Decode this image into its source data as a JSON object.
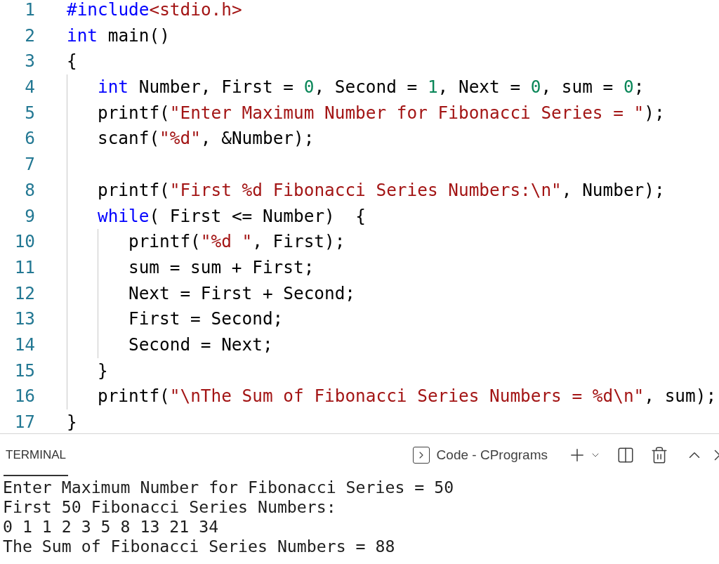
{
  "editor": {
    "lines": [
      {
        "number": "1",
        "tokens": [
          {
            "kind": "keyword",
            "text": "#include"
          },
          {
            "kind": "string",
            "text": "<stdio.h>"
          }
        ]
      },
      {
        "number": "2",
        "tokens": [
          {
            "kind": "keyword",
            "text": "int"
          },
          {
            "kind": "plain",
            "text": " main()"
          }
        ]
      },
      {
        "number": "3",
        "tokens": [
          {
            "kind": "plain",
            "text": "{"
          }
        ],
        "children": [
          {
            "number": "4",
            "tokens": [
              {
                "kind": "keyword",
                "text": "int"
              },
              {
                "kind": "plain",
                "text": " Number, First = "
              },
              {
                "kind": "number",
                "text": "0"
              },
              {
                "kind": "plain",
                "text": ", Second = "
              },
              {
                "kind": "number",
                "text": "1"
              },
              {
                "kind": "plain",
                "text": ", Next = "
              },
              {
                "kind": "number",
                "text": "0"
              },
              {
                "kind": "plain",
                "text": ", sum = "
              },
              {
                "kind": "number",
                "text": "0"
              },
              {
                "kind": "plain",
                "text": ";"
              }
            ]
          },
          {
            "number": "5",
            "tokens": [
              {
                "kind": "plain",
                "text": "printf("
              },
              {
                "kind": "string",
                "text": "\"Enter Maximum Number for Fibonacci Series = \""
              },
              {
                "kind": "plain",
                "text": ");"
              }
            ]
          },
          {
            "number": "6",
            "tokens": [
              {
                "kind": "plain",
                "text": "scanf("
              },
              {
                "kind": "string",
                "text": "\"%d\""
              },
              {
                "kind": "plain",
                "text": ", &Number);"
              }
            ]
          },
          {
            "number": "7"
          },
          {
            "number": "8",
            "tokens": [
              {
                "kind": "plain",
                "text": "printf("
              },
              {
                "kind": "string",
                "text": "\"First %d Fibonacci Series Numbers:\\n\""
              },
              {
                "kind": "plain",
                "text": ", Number);"
              }
            ]
          },
          {
            "number": "9",
            "tokens": [
              {
                "kind": "keyword",
                "text": "while"
              },
              {
                "kind": "plain",
                "text": "( First <= Number)  {"
              }
            ],
            "children": [
              {
                "number": "10",
                "tokens": [
                  {
                    "kind": "plain",
                    "text": "printf("
                  },
                  {
                    "kind": "string",
                    "text": "\"%d \""
                  },
                  {
                    "kind": "plain",
                    "text": ", First);"
                  }
                ]
              },
              {
                "number": "11",
                "tokens": [
                  {
                    "kind": "plain",
                    "text": "sum = sum + First;"
                  }
                ]
              },
              {
                "number": "12",
                "tokens": [
                  {
                    "kind": "plain",
                    "text": "Next = First + Second;"
                  }
                ]
              },
              {
                "number": "13",
                "tokens": [
                  {
                    "kind": "plain",
                    "text": "First = Second;"
                  }
                ]
              },
              {
                "number": "14",
                "tokens": [
                  {
                    "kind": "plain",
                    "text": "Second = Next;"
                  }
                ]
              }
            ]
          },
          {
            "number": "15",
            "tokens": [
              {
                "kind": "plain",
                "text": "}"
              }
            ]
          },
          {
            "number": "16",
            "tokens": [
              {
                "kind": "plain",
                "text": "printf("
              },
              {
                "kind": "string",
                "text": "\"\\nThe Sum of Fibonacci Series Numbers = %d\\n\""
              },
              {
                "kind": "plain",
                "text": ", sum);"
              }
            ]
          }
        ]
      },
      {
        "number": "17",
        "tokens": [
          {
            "kind": "plain",
            "text": "}"
          }
        ]
      }
    ]
  },
  "terminal": {
    "tab": "TERMINAL",
    "shell": "Code - CPrograms",
    "output": [
      "Enter Maximum Number for Fibonacci Series = 50",
      "First 50 Fibonacci Series Numbers:",
      "0 1 1 2 3 5 8 13 21 34",
      "The Sum of Fibonacci Series Numbers = 88"
    ]
  }
}
